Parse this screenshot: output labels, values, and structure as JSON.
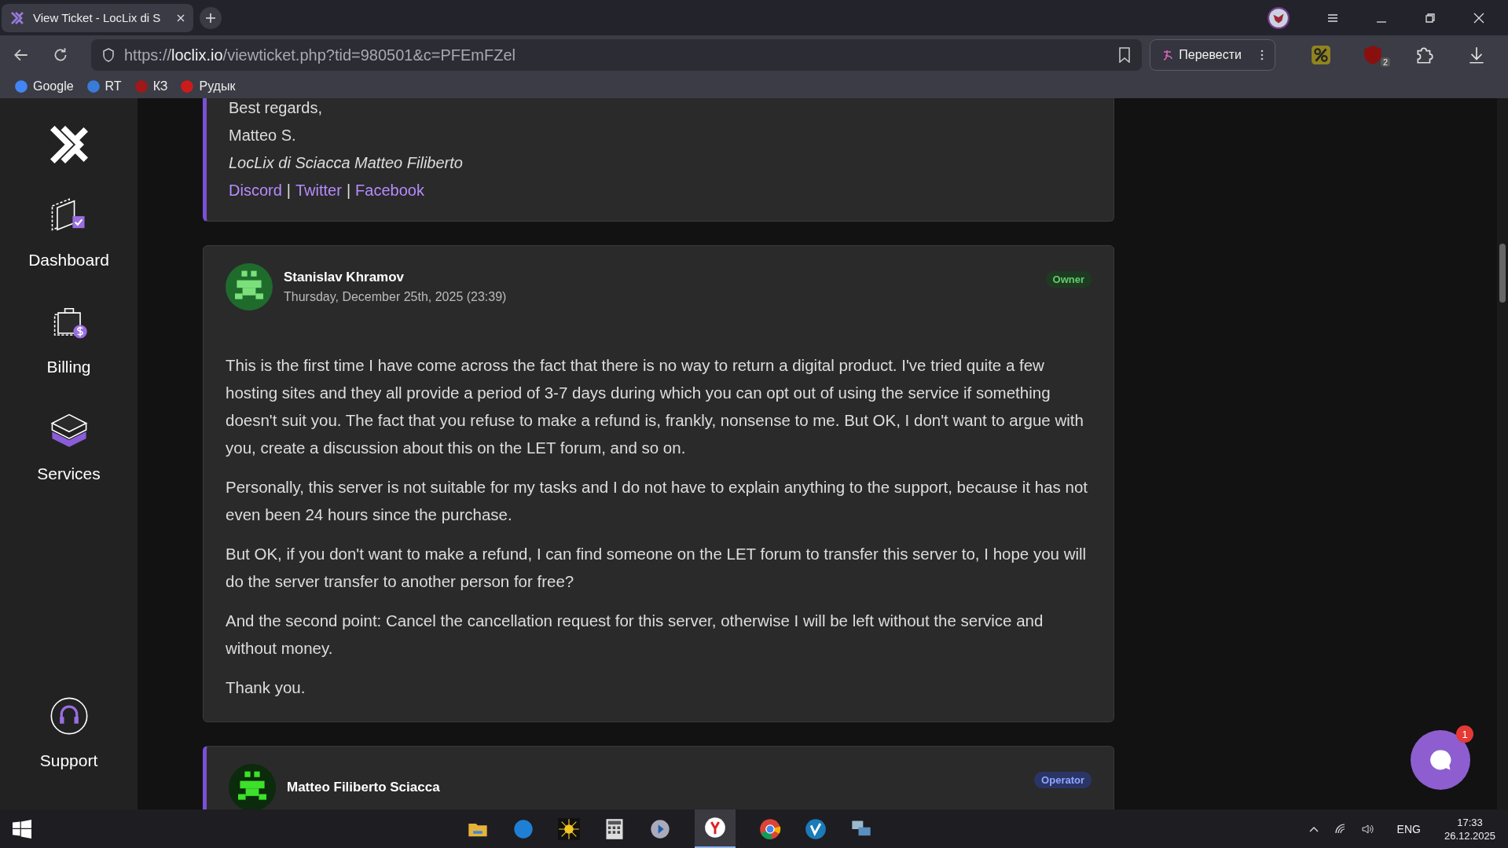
{
  "browser": {
    "tab_title": "View Ticket - LocLix di S",
    "url_prefix": "https://",
    "url_host": "loclix.io",
    "url_path": "/viewticket.php?tid=980501&c=PFEmFZel",
    "translate_button": "Перевести",
    "extension_badge": "2",
    "bookmarks": [
      "Google",
      "RT",
      "КЗ",
      "Рудык"
    ]
  },
  "sidebar": {
    "items": [
      {
        "label": "Dashboard",
        "kind": "dashboard"
      },
      {
        "label": "Billing",
        "kind": "billing"
      },
      {
        "label": "Services",
        "kind": "services"
      }
    ],
    "support": "Support"
  },
  "previous_message": {
    "lines": [
      "Best regards,",
      "Matteo S."
    ],
    "company": "LocLix di Sciacca Matteo Filiberto",
    "links": [
      "Discord",
      "Twitter",
      "Facebook"
    ],
    "separator": "|"
  },
  "replies": [
    {
      "author": "Stanislav Khramov",
      "date": "Thursday, December 25th, 2025 (23:39)",
      "role": "Owner",
      "kind": "owner",
      "paragraphs": [
        "This is the first time I have come across the fact that there is no way to return a digital product. I've tried quite a few hosting sites and they all provide a period of 3-7 days during which you can opt out of using the service if something doesn't suit you. The fact that you refuse to make a refund is, frankly, nonsense to me. But OK, I don't want to argue with you, create a discussion about this on the LET forum, and so on.",
        "Personally, this server is not suitable for my tasks and I do not have to explain anything to the support, because it has not even been 24 hours since the purchase.",
        "But OK, if you don't want to make a refund, I can find someone on the LET forum to transfer this server to, I hope you will do the server transfer to another person for free?",
        "And the second point: Cancel the cancellation request for this server, otherwise I will be left without the service and without money.",
        "Thank you."
      ]
    },
    {
      "author": "Matteo Filiberto Sciacca",
      "role": "Operator",
      "kind": "operator"
    }
  ],
  "chat_widget": {
    "badge": "1"
  },
  "taskbar": {
    "language": "ENG",
    "time": "17:33",
    "date": "26.12.2025"
  }
}
